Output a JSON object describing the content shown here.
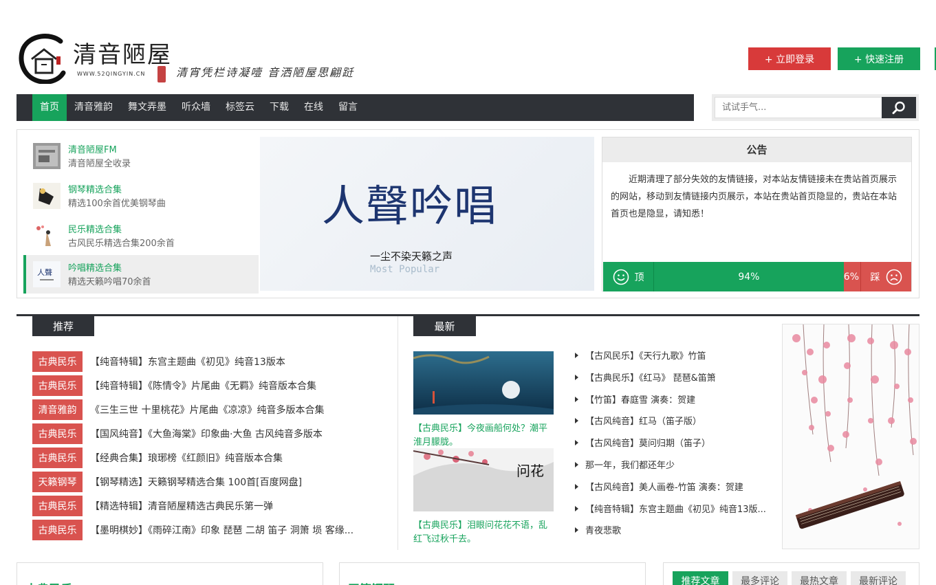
{
  "header": {
    "site_name": "清音陋屋",
    "domain": "WWW.52QINGYIN.CN",
    "slogan": "清宵凭栏诗凝噎 音洒陋屋思翩跹",
    "login_label": "+ 立即登录",
    "register_label": "+ 快速注册"
  },
  "nav": {
    "items": [
      "首页",
      "清音雅韵",
      "舞文弄墨",
      "听众墙",
      "标签云",
      "下载",
      "在线",
      "留言"
    ],
    "active_index": 0
  },
  "search": {
    "placeholder": "试试手气...",
    "icon": "search-icon"
  },
  "featured": {
    "items": [
      {
        "title": "清音陋屋FM",
        "desc": "清音陋屋全收录"
      },
      {
        "title": "钢琴精选合集",
        "desc": "精选100余首优美钢琴曲"
      },
      {
        "title": "民乐精选合集",
        "desc": "古风民乐精选合集200余首"
      },
      {
        "title": "吟唱精选合集",
        "desc": "精选天籁吟唱70余首"
      }
    ],
    "active_index": 3,
    "banner": {
      "calligraphy": "人聲吟唱",
      "sub": "一尘不染天籁之声",
      "en": "Most Popular"
    }
  },
  "notice": {
    "title": "公告",
    "text": "近期清理了部分失效的友情链接，对本站友情链接未在贵站首页展示的网站，移动到友情链接内页展示，本站在贵站首页隐显的，贵站在本站首页也是隐显，请知悉！",
    "up_label": "顶",
    "down_label": "踩",
    "up_percent": 94,
    "down_percent": 6,
    "up_percent_text": "94%",
    "down_percent_text": "6%"
  },
  "recommend": {
    "tab": "推荐",
    "rows": [
      {
        "cat": "古典民乐",
        "title": "【纯音特辑】东宫主题曲《初见》纯音13版本"
      },
      {
        "cat": "古典民乐",
        "title": "【纯音特辑】《陈情令》片尾曲《无羁》纯音版本合集"
      },
      {
        "cat": "清音雅韵",
        "title": "《三生三世 十里桃花》片尾曲《凉凉》纯音多版本合集"
      },
      {
        "cat": "古典民乐",
        "title": "【国风纯音】《大鱼海棠》印象曲·大鱼 古风纯音多版本"
      },
      {
        "cat": "古典民乐",
        "title": "【经典合集】琅琊榜《红颜旧》纯音版本合集"
      },
      {
        "cat": "天籁钢琴",
        "title": "【钢琴精选】天籁钢琴精选合集 100首[百度网盘]"
      },
      {
        "cat": "古典民乐",
        "title": "【精选特辑】清音陋屋精选古典民乐第一弹"
      },
      {
        "cat": "古典民乐",
        "title": "【墨明棋妙】《雨碎江南》印象 琵琶 二胡 笛子 洞箫 埙 客缘..."
      }
    ]
  },
  "latest": {
    "tab": "最新",
    "cards": [
      {
        "caption": "【古典民乐】今夜画船何处？潮平淮月朦胧。"
      },
      {
        "caption": "【古典民乐】泪眼问花花不语，乱红飞过秋千去。",
        "overlay": "问花"
      }
    ],
    "list": [
      "【古风民乐】《天行九歌》竹笛",
      "【古典民乐】《红马》 琵琶&笛箫",
      "【竹笛】春庭雪 演奏：贺建",
      "【古风纯音】红马（笛子版）",
      "【古风纯音】莫问归期（笛子）",
      "那一年，我们都还年少",
      "【古风纯音】美人画卷-竹笛 演奏：贺建",
      "【纯音特辑】东宫主题曲《初见》纯音13版...",
      "青夜悲歌"
    ]
  },
  "bottom": {
    "box1_title": "古典民乐",
    "box2_title": "天籁钢琴",
    "tabs": [
      "推荐文章",
      "最多评论",
      "最热文章",
      "最新评论"
    ],
    "active_tab": 0
  },
  "colors": {
    "accent_green": "#17a35c",
    "accent_red": "#d9534f",
    "nav_dark": "#2f3237"
  }
}
